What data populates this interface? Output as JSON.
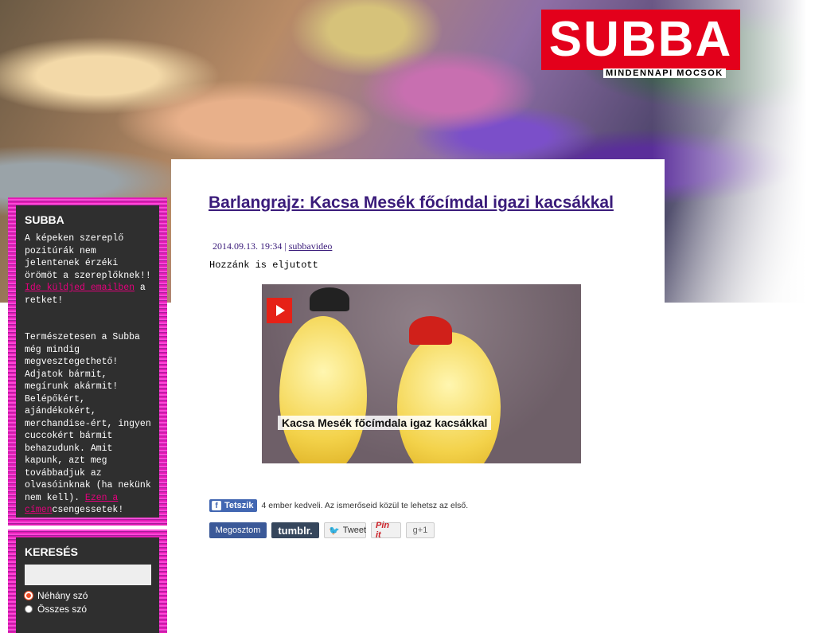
{
  "header": {
    "logo_text": "SUBBA",
    "tagline": "MINDENNAPI MOCSOK"
  },
  "sidebar": {
    "about": {
      "title": "SUBBA",
      "text_1": "A képeken szereplő pozitúrák nem jelentenek érzéki örömöt a szereplőknek!! ",
      "link_1": "Ide küldjed emailben",
      "text_2": " a retket!",
      "text_3": "Természetesen a Subba még mindig megvesztegethető! Adjatok bármit, megírunk akármit! Belépőkért, ajándékokért, merchandise-ért, ingyen cuccokért bármit behazudunk. Amit kapunk, azt meg továbbadjuk az olvasóinknak (ha nekünk nem kell). ",
      "link_2": "Ezen a címen",
      "text_4": "csengessetek!"
    },
    "search": {
      "title": "KERESÉS",
      "input_value": "",
      "options": [
        "Néhány szó",
        "Összes szó"
      ],
      "selected": "Néhány szó"
    }
  },
  "post": {
    "title": "Barlangrajz: Kacsa Mesék főcímdal igazi kacsákkal",
    "date": "2014.09.13. 19:34",
    "separator": " | ",
    "author": "subbavideo",
    "intro": "Hozzánk is eljutott",
    "video": {
      "caption": "Kacsa Mesék főcímdala igaz kacsákkal"
    }
  },
  "social": {
    "like_label": "Tetszik",
    "like_text": "4 ember kedveli. Az ismerőseid közül te lehetsz az első.",
    "share_facebook": "Megosztom",
    "share_tumblr": "tumblr.",
    "share_tweet": "Tweet",
    "share_pinterest": "Pin it",
    "share_gplus": "g+1"
  },
  "colors": {
    "brand_red": "#e3001b",
    "sidebar_pink": "#e21bb5",
    "link_purple": "#3a1b7a",
    "link_pink": "#e4007c"
  }
}
